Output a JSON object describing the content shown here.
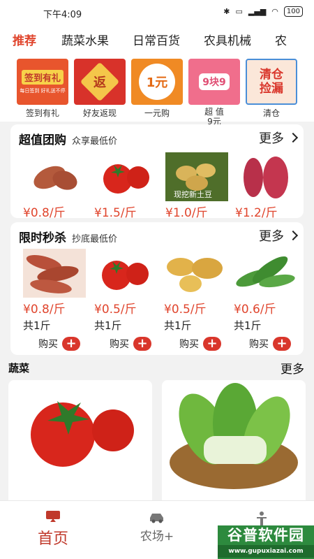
{
  "status": {
    "time": "下午4:09",
    "battery": "100"
  },
  "tabs": [
    "推荐",
    "蔬菜水果",
    "日常百货",
    "农具机械",
    "农"
  ],
  "categories": [
    {
      "label": "签到有礼",
      "badge": "签到有礼",
      "sub": "每日签到 好礼送不停"
    },
    {
      "label": "好友返现",
      "badge": "返"
    },
    {
      "label": "一元购",
      "badge": "1元"
    },
    {
      "label": "9元",
      "badge": "9块9",
      "sub": "超 值"
    },
    {
      "label": "清仓",
      "badge": "清仓捡漏"
    }
  ],
  "group_buy": {
    "title": "超值团购",
    "subtitle": "众享最低价",
    "more": "更多",
    "items": [
      {
        "price": "¥0.8/斤",
        "img": "sweet-potato"
      },
      {
        "price": "¥1.5/斤",
        "img": "tomato"
      },
      {
        "price": "¥1.0/斤",
        "img": "potato",
        "tag": "现挖新土豆"
      },
      {
        "price": "¥1.2/斤",
        "img": "sweet-potato-red"
      }
    ]
  },
  "flash_sale": {
    "title": "限时秒杀",
    "subtitle": "抄底最低价",
    "more": "更多",
    "buy_label": "购买",
    "items": [
      {
        "price": "¥0.8/斤",
        "qty": "共1斤",
        "img": "sweet-potato"
      },
      {
        "price": "¥0.5/斤",
        "qty": "共1斤",
        "img": "tomato"
      },
      {
        "price": "¥0.5/斤",
        "qty": "共1斤",
        "img": "potato"
      },
      {
        "price": "¥0.6/斤",
        "qty": "共1斤",
        "img": "greens"
      }
    ]
  },
  "veg_section": {
    "title": "蔬菜",
    "more": "更多"
  },
  "tabbar": [
    {
      "label": "首页",
      "icon": "screen-icon",
      "active": true
    },
    {
      "label": "农场+",
      "icon": "car-icon",
      "active": false
    },
    {
      "label": "",
      "icon": "person-icon",
      "active": false
    }
  ],
  "watermark": {
    "title": "谷普软件园",
    "url": "www.gupuxiazai.com"
  },
  "colors": {
    "accent": "#e0452d",
    "plus": "#d9362b"
  }
}
